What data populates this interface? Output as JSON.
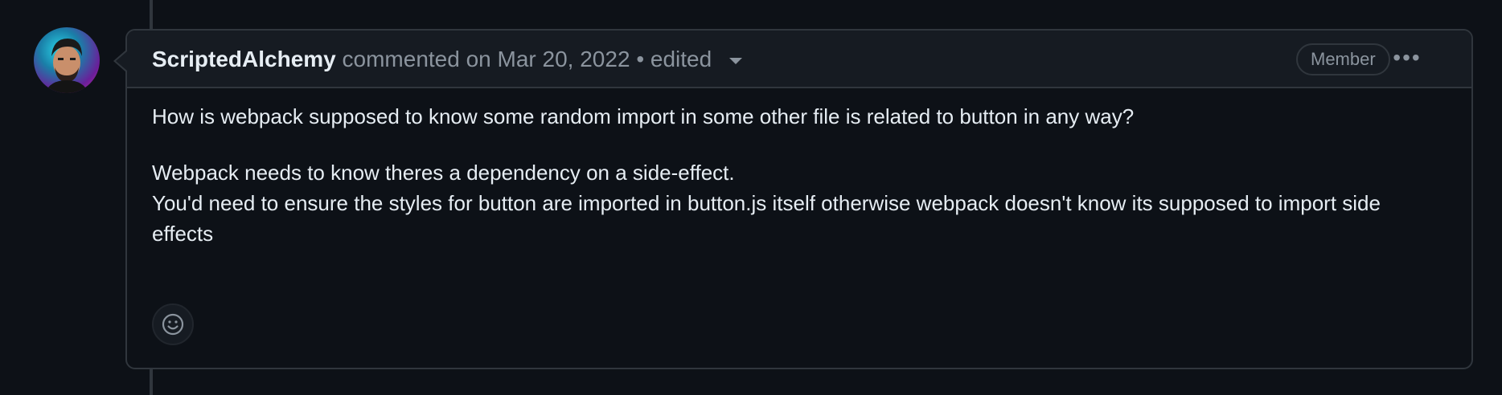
{
  "comment": {
    "author": "ScriptedAlchemy",
    "action": "commented on",
    "date": "Mar 20, 2022",
    "separator": "•",
    "edited_label": "edited",
    "badge": "Member",
    "more_label": "•••",
    "body": {
      "paragraph1": "How is webpack supposed to know some random import in some other file is related to button in any way?",
      "paragraph2_line1": "Webpack needs to know theres a dependency on a side-effect.",
      "paragraph2_line2": "You'd need to ensure the styles for button are imported in button.js itself otherwise webpack doesn't know its supposed to import side effects"
    },
    "icons": {
      "avatar": "avatar-image",
      "edited_dropdown": "chevron-down-icon",
      "more": "kebab-horizontal-icon",
      "reaction": "smiley-icon"
    }
  },
  "colors": {
    "background": "#0d1117",
    "header_background": "#161b22",
    "border": "#30363d",
    "text_primary": "#e6edf3",
    "text_muted": "#8b949e"
  }
}
